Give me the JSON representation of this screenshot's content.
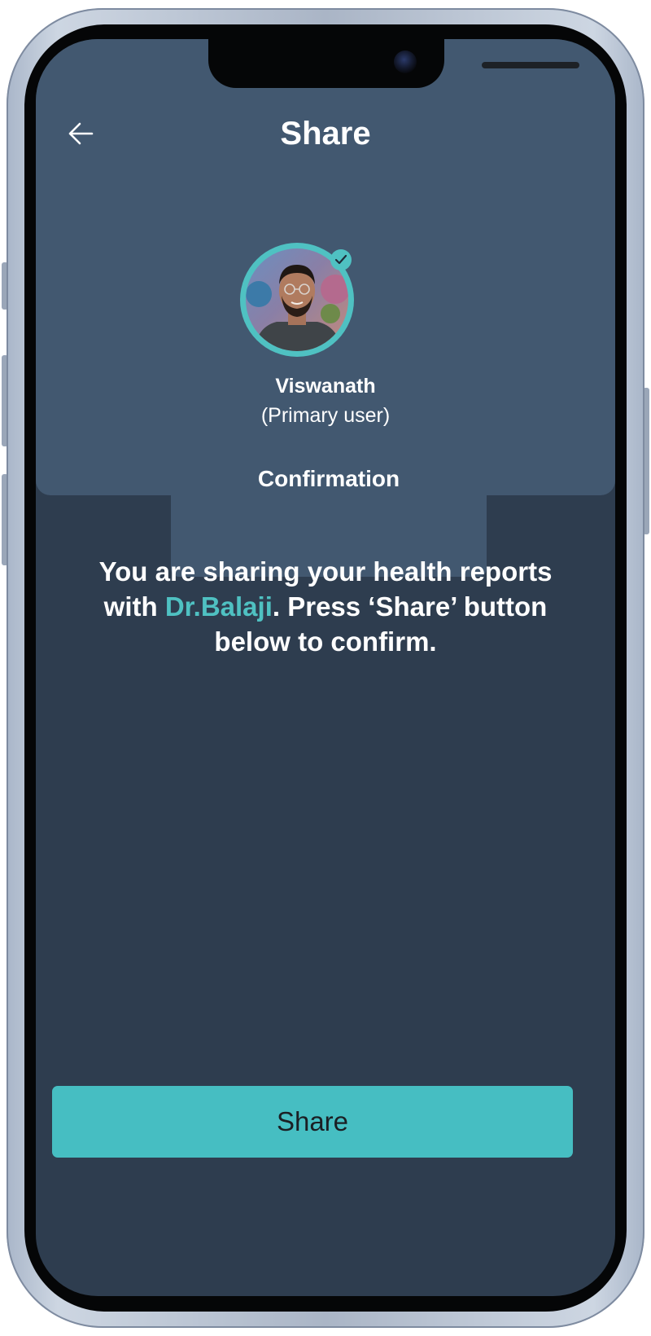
{
  "header": {
    "title": "Share",
    "back_icon": "arrow-left-icon"
  },
  "profile": {
    "name": "Viswanath",
    "role": "(Primary user)",
    "verified_icon": "check-badge-icon"
  },
  "tab": {
    "label": "Confirmation"
  },
  "message": {
    "prefix": "You are sharing your health reports with ",
    "doctor": "Dr.Balaji",
    "suffix": ". Press ‘Share’ button below to confirm."
  },
  "actions": {
    "share_label": "Share"
  },
  "colors": {
    "accent": "#46bec2",
    "header_bg": "#425870",
    "screen_bg": "#2e3d4f"
  }
}
